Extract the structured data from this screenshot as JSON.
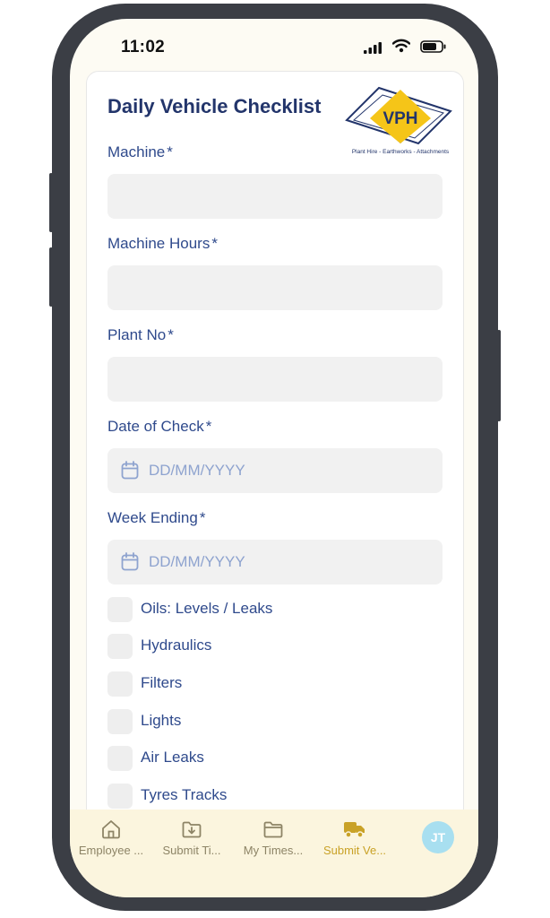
{
  "status_bar": {
    "time": "11:02"
  },
  "form": {
    "title": "Daily Vehicle Checklist",
    "logo": {
      "text": "VPH",
      "tagline": "Plant Hire - Earthworks - Attachments"
    },
    "required_marker": "*",
    "fields": [
      {
        "label": "Machine",
        "value": ""
      },
      {
        "label": "Machine Hours",
        "value": ""
      },
      {
        "label": "Plant No",
        "value": ""
      },
      {
        "label": "Date of Check",
        "placeholder": "DD/MM/YYYY"
      },
      {
        "label": "Week Ending",
        "placeholder": "DD/MM/YYYY"
      }
    ],
    "checklist": [
      {
        "label": "Oils: Levels / Leaks",
        "checked": false
      },
      {
        "label": "Hydraulics",
        "checked": false
      },
      {
        "label": "Filters",
        "checked": false
      },
      {
        "label": "Lights",
        "checked": false
      },
      {
        "label": "Air Leaks",
        "checked": false
      },
      {
        "label": "Tyres Tracks",
        "checked": false
      }
    ]
  },
  "bottom_nav": {
    "items": [
      {
        "label": "Employee ...",
        "icon": "home-icon"
      },
      {
        "label": "Submit Ti...",
        "icon": "folder-download-icon"
      },
      {
        "label": "My Times...",
        "icon": "folder-icon"
      },
      {
        "label": "Submit Ve...",
        "icon": "truck-icon",
        "active": true
      }
    ],
    "avatar_initials": "JT"
  },
  "colors": {
    "primary_text": "#23356b",
    "label_text": "#2f4a8c",
    "placeholder": "#8ea3cf",
    "brand_yellow": "#f5c518",
    "nav_active": "#c9a227",
    "nav_bg": "#fbf5de",
    "avatar_bg": "#a8dff0"
  }
}
